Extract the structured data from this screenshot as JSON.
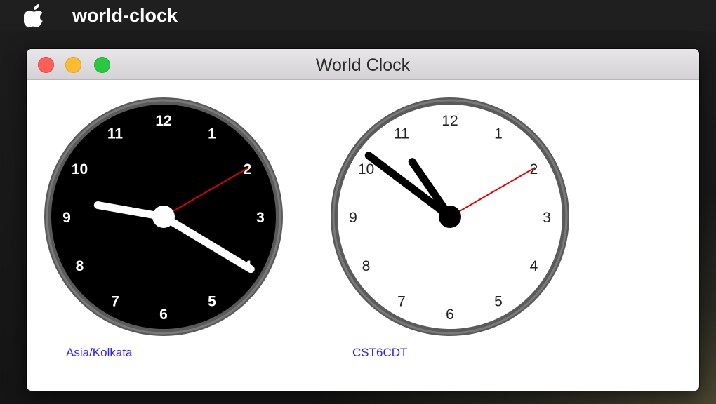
{
  "menubar": {
    "apple_icon": "apple-logo-icon",
    "app_name": "world-clock"
  },
  "window": {
    "title": "World Clock",
    "controls": [
      "close-button",
      "minimize-button",
      "zoom-button"
    ]
  },
  "clocks": [
    {
      "timezone": "Asia/Kolkata",
      "theme": "dark",
      "face_color": "#000000",
      "numeral_color": "#ffffff",
      "hand_color": "#ffffff",
      "second_hand_color": "#e00000",
      "time": {
        "hour": 9,
        "minute": 20,
        "second": 10
      }
    },
    {
      "timezone": "CST6CDT",
      "theme": "light",
      "face_color": "#ffffff",
      "numeral_color": "#222222",
      "hand_color": "#000000",
      "second_hand_color": "#e00000",
      "time": {
        "hour": 10,
        "minute": 51,
        "second": 10
      }
    }
  ],
  "numerals": [
    "12",
    "1",
    "2",
    "3",
    "4",
    "5",
    "6",
    "7",
    "8",
    "9",
    "10",
    "11"
  ],
  "colors": {
    "label_blue": "#2b1ff5",
    "rim": "#5a5a5a"
  }
}
